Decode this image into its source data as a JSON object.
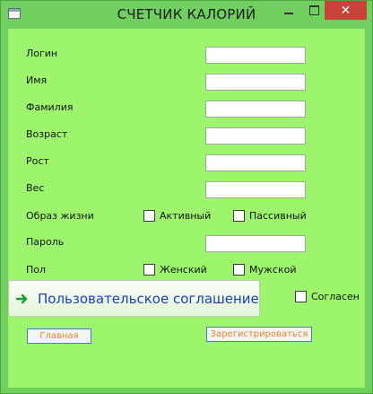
{
  "window": {
    "title": "СЧЕТЧИК КАЛОРИЙ",
    "close_glyph": "✕"
  },
  "form": {
    "login_label": "Логин",
    "name_label": "Имя",
    "surname_label": "Фамилия",
    "age_label": "Возраст",
    "height_label": "Рост",
    "weight_label": "Вес",
    "lifestyle_label": "Образ жизни",
    "lifestyle_active": "Активный",
    "lifestyle_passive": "Пассивный",
    "password_label": "Пароль",
    "gender_label": "Пол",
    "gender_female": "Женский",
    "gender_male": "Мужской"
  },
  "agreement": {
    "button_label": "Пользовательское соглашение",
    "agree_label": "Согласен"
  },
  "buttons": {
    "home": "Главная",
    "register": "Зарегистрироваться"
  },
  "colors": {
    "client_bg": "#9cf56d",
    "frame": "#6fcf5f",
    "close": "#c74337",
    "button_text": "#e08a2a",
    "link_text": "#1a3fb8"
  }
}
